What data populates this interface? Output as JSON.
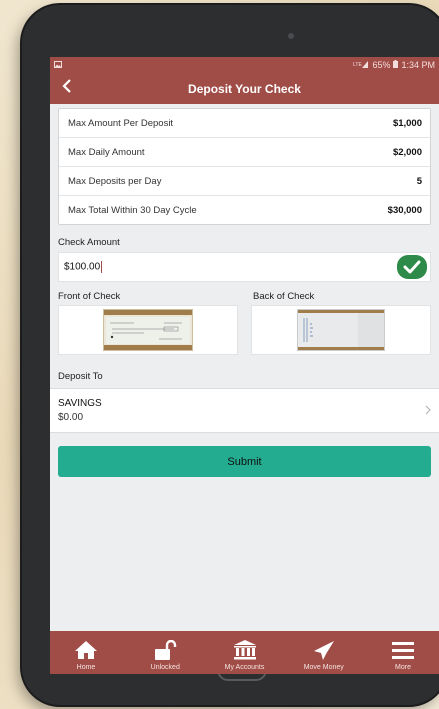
{
  "status_bar": {
    "battery_percent": "65%",
    "time": "1:34 PM",
    "network_icon": "lte-signal-icon"
  },
  "header": {
    "title": "Deposit Your Check",
    "back_icon": "chevron-left-icon"
  },
  "limits": [
    {
      "label": "Max Amount Per Deposit",
      "value": "$1,000"
    },
    {
      "label": "Max Daily Amount",
      "value": "$2,000"
    },
    {
      "label": "Max Deposits per Day",
      "value": "5"
    },
    {
      "label": "Max Total Within 30 Day Cycle",
      "value": "$30,000"
    }
  ],
  "check_amount": {
    "label": "Check Amount",
    "value": "$100.00",
    "valid_icon": "checkmark-circle-icon"
  },
  "front_of_check": {
    "label": "Front of Check"
  },
  "back_of_check": {
    "label": "Back of Check"
  },
  "deposit_to": {
    "label": "Deposit To",
    "account_name": "SAVINGS",
    "balance": "$0.00"
  },
  "submit_label": "Submit",
  "tab_bar": [
    {
      "label": "Home",
      "icon": "home-icon"
    },
    {
      "label": "Unlocked",
      "icon": "unlock-icon"
    },
    {
      "label": "My Accounts",
      "icon": "bank-icon"
    },
    {
      "label": "Move Money",
      "icon": "paper-plane-icon"
    },
    {
      "label": "More",
      "icon": "menu-icon"
    }
  ],
  "colors": {
    "brand": "#a14d47",
    "accent": "#23ac8f",
    "valid": "#2e8a48"
  }
}
